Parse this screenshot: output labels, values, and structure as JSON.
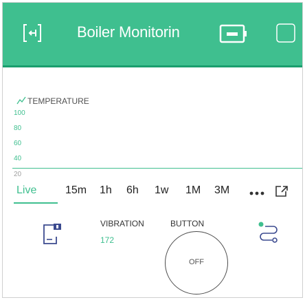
{
  "header": {
    "title": "Boiler Monitorin",
    "colors": {
      "bar": "#3fbf8f",
      "bar_border": "#1a9e6e"
    },
    "icons": {
      "back": "back-icon",
      "device": "device-icon",
      "square": "square-icon"
    }
  },
  "chart": {
    "label": "TEMPERATURE",
    "icon": "line-chart-icon",
    "y_ticks": [
      "100",
      "80",
      "60",
      "40",
      "20"
    ],
    "accent": "#3fbf8f"
  },
  "chart_data": {
    "type": "line",
    "title": "TEMPERATURE",
    "y_ticks": [
      100,
      80,
      60,
      40,
      20
    ],
    "ylim": [
      20,
      100
    ],
    "series": [],
    "grid": false
  },
  "time_ranges": {
    "items": [
      "Live",
      "15m",
      "1h",
      "6h",
      "1w",
      "1M",
      "3M"
    ],
    "selected": "Live",
    "more_icon": "more-dots-icon",
    "expand_icon": "expand-icon"
  },
  "widgets": {
    "doc_icon": "document-icon",
    "vibration": {
      "label": "VIBRATION",
      "value": "172"
    },
    "button": {
      "label": "BUTTON",
      "state": "OFF"
    },
    "flow_icon": "flow-icon"
  }
}
